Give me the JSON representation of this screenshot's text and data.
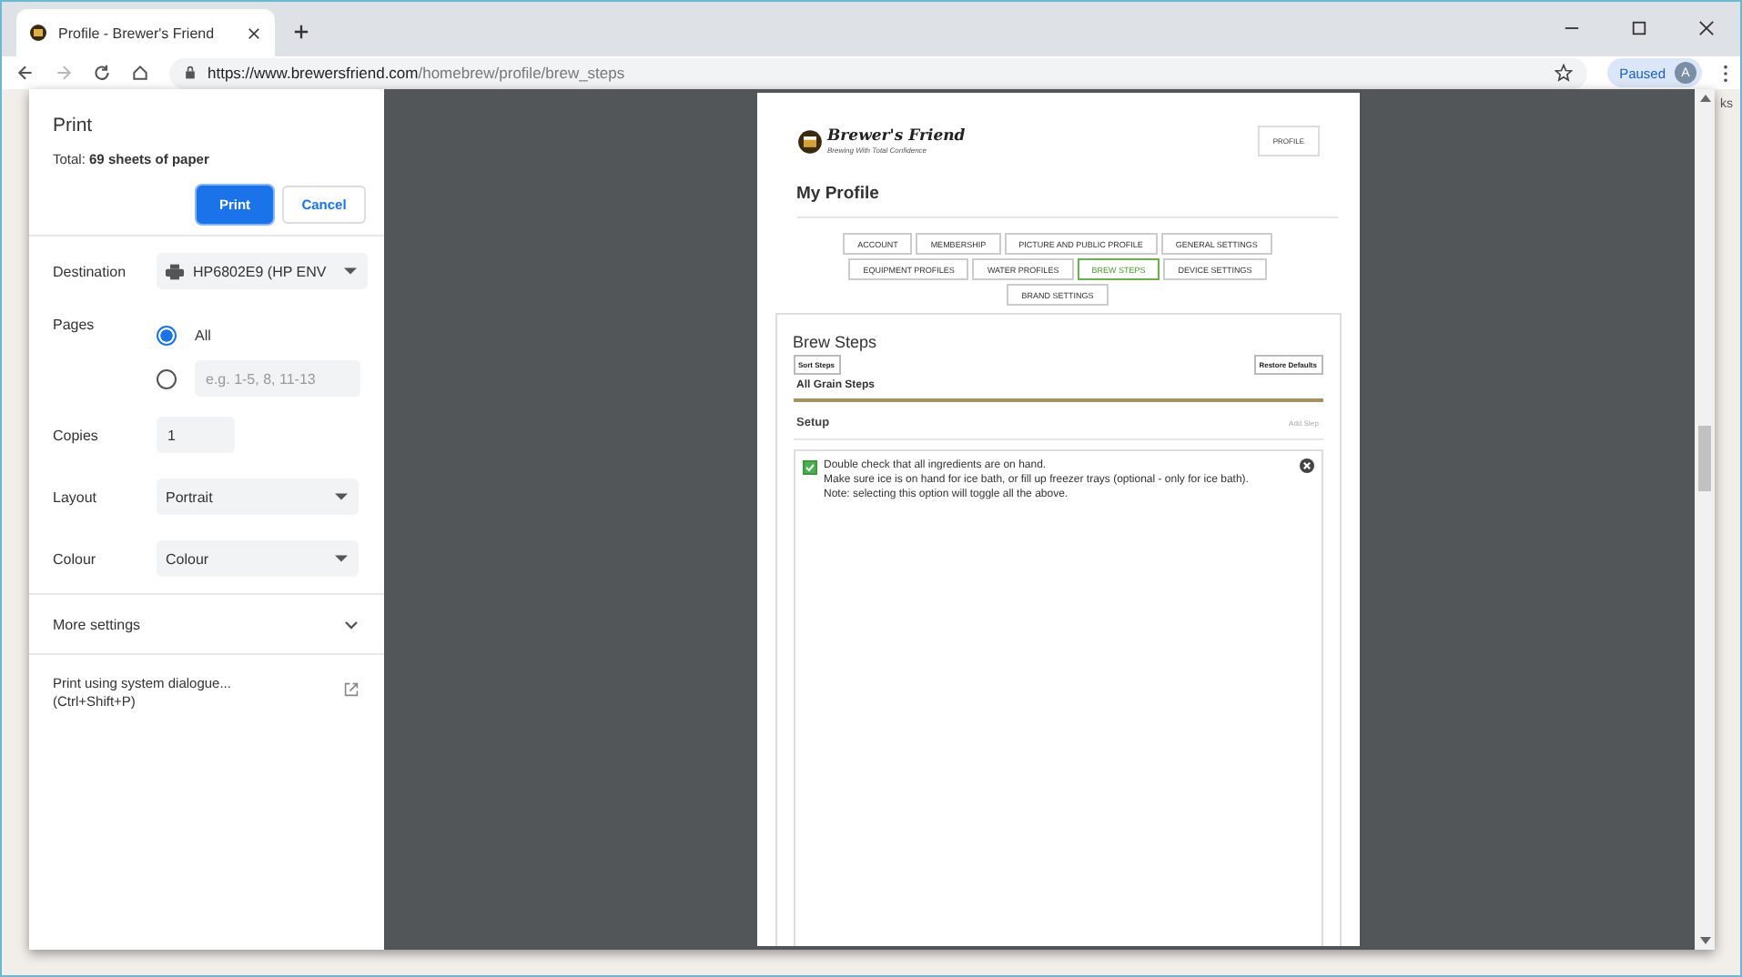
{
  "browser": {
    "tab_title": "Profile - Brewer's Friend",
    "url_host": "https://www.brewersfriend.com",
    "url_path": "/homebrew/profile/brew_steps",
    "profile_status": "Paused",
    "avatar_letter": "A",
    "bookmarks_fragment": "ks"
  },
  "print": {
    "title": "Print",
    "total_label": "Total: ",
    "total_value": "69 sheets of paper",
    "print_button": "Print",
    "cancel_button": "Cancel",
    "destination": {
      "label": "Destination",
      "value": "HP6802E9 (HP ENV"
    },
    "pages": {
      "label": "Pages",
      "options": [
        {
          "kind": "all",
          "label": "All",
          "selected": true
        },
        {
          "kind": "custom",
          "placeholder": "e.g. 1-5, 8, 11-13",
          "selected": false
        }
      ]
    },
    "copies": {
      "label": "Copies",
      "value": "1"
    },
    "layout": {
      "label": "Layout",
      "value": "Portrait"
    },
    "colour": {
      "label": "Colour",
      "value": "Colour"
    },
    "more_settings": "More settings",
    "system_dialog": {
      "line1": "Print using system dialogue...",
      "line2": "(Ctrl+Shift+P)"
    }
  },
  "preview": {
    "logo_name": "Brewer's Friend",
    "logo_tagline": "Brewing With Total Confidence",
    "profile_button": "PROFILE",
    "heading": "My Profile",
    "tabs": [
      {
        "label": "ACCOUNT",
        "selected": false
      },
      {
        "label": "MEMBERSHIP",
        "selected": false
      },
      {
        "label": "PICTURE AND PUBLIC PROFILE",
        "selected": false
      },
      {
        "label": "GENERAL SETTINGS",
        "selected": false
      },
      {
        "label": "EQUIPMENT PROFILES",
        "selected": false
      },
      {
        "label": "WATER PROFILES",
        "selected": false
      },
      {
        "label": "BREW STEPS",
        "selected": true
      },
      {
        "label": "DEVICE SETTINGS",
        "selected": false
      },
      {
        "label": "BRAND SETTINGS",
        "selected": false
      }
    ],
    "section_title": "Brew Steps",
    "sort_button": "Sort Steps",
    "restore_button": "Restore Defaults",
    "group_title": "All Grain Steps",
    "stage_title": "Setup",
    "add_step": "Add Step",
    "step": {
      "checked": true,
      "lines": [
        "Double check that all ingredients are on hand.",
        "Make sure ice is on hand for ice bath, or fill up freezer trays (optional - only for ice bath).",
        "Note: selecting this option will toggle all the above."
      ]
    }
  }
}
